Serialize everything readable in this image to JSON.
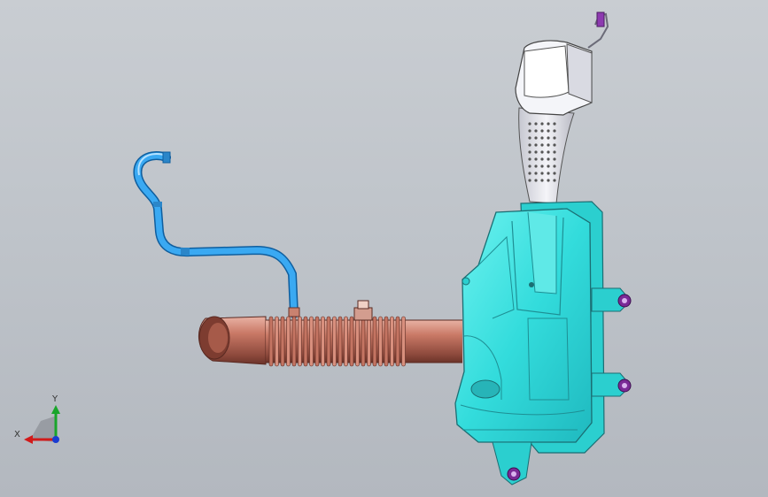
{
  "viewport": {
    "background_top": "#c9cdd2",
    "background_bottom": "#b3b8bf"
  },
  "triad": {
    "x_label": "X",
    "y_label": "Y",
    "x_color": "#d11a1a",
    "y_color": "#19a52b",
    "z_color": "#1a3cd1"
  },
  "model": {
    "housing_color": "#2fe0e0",
    "duct_color": "#b7685a",
    "hose_color": "#33a8f0",
    "snorkel_color": "#dcdde3",
    "grommet_color": "#7a2a96"
  }
}
